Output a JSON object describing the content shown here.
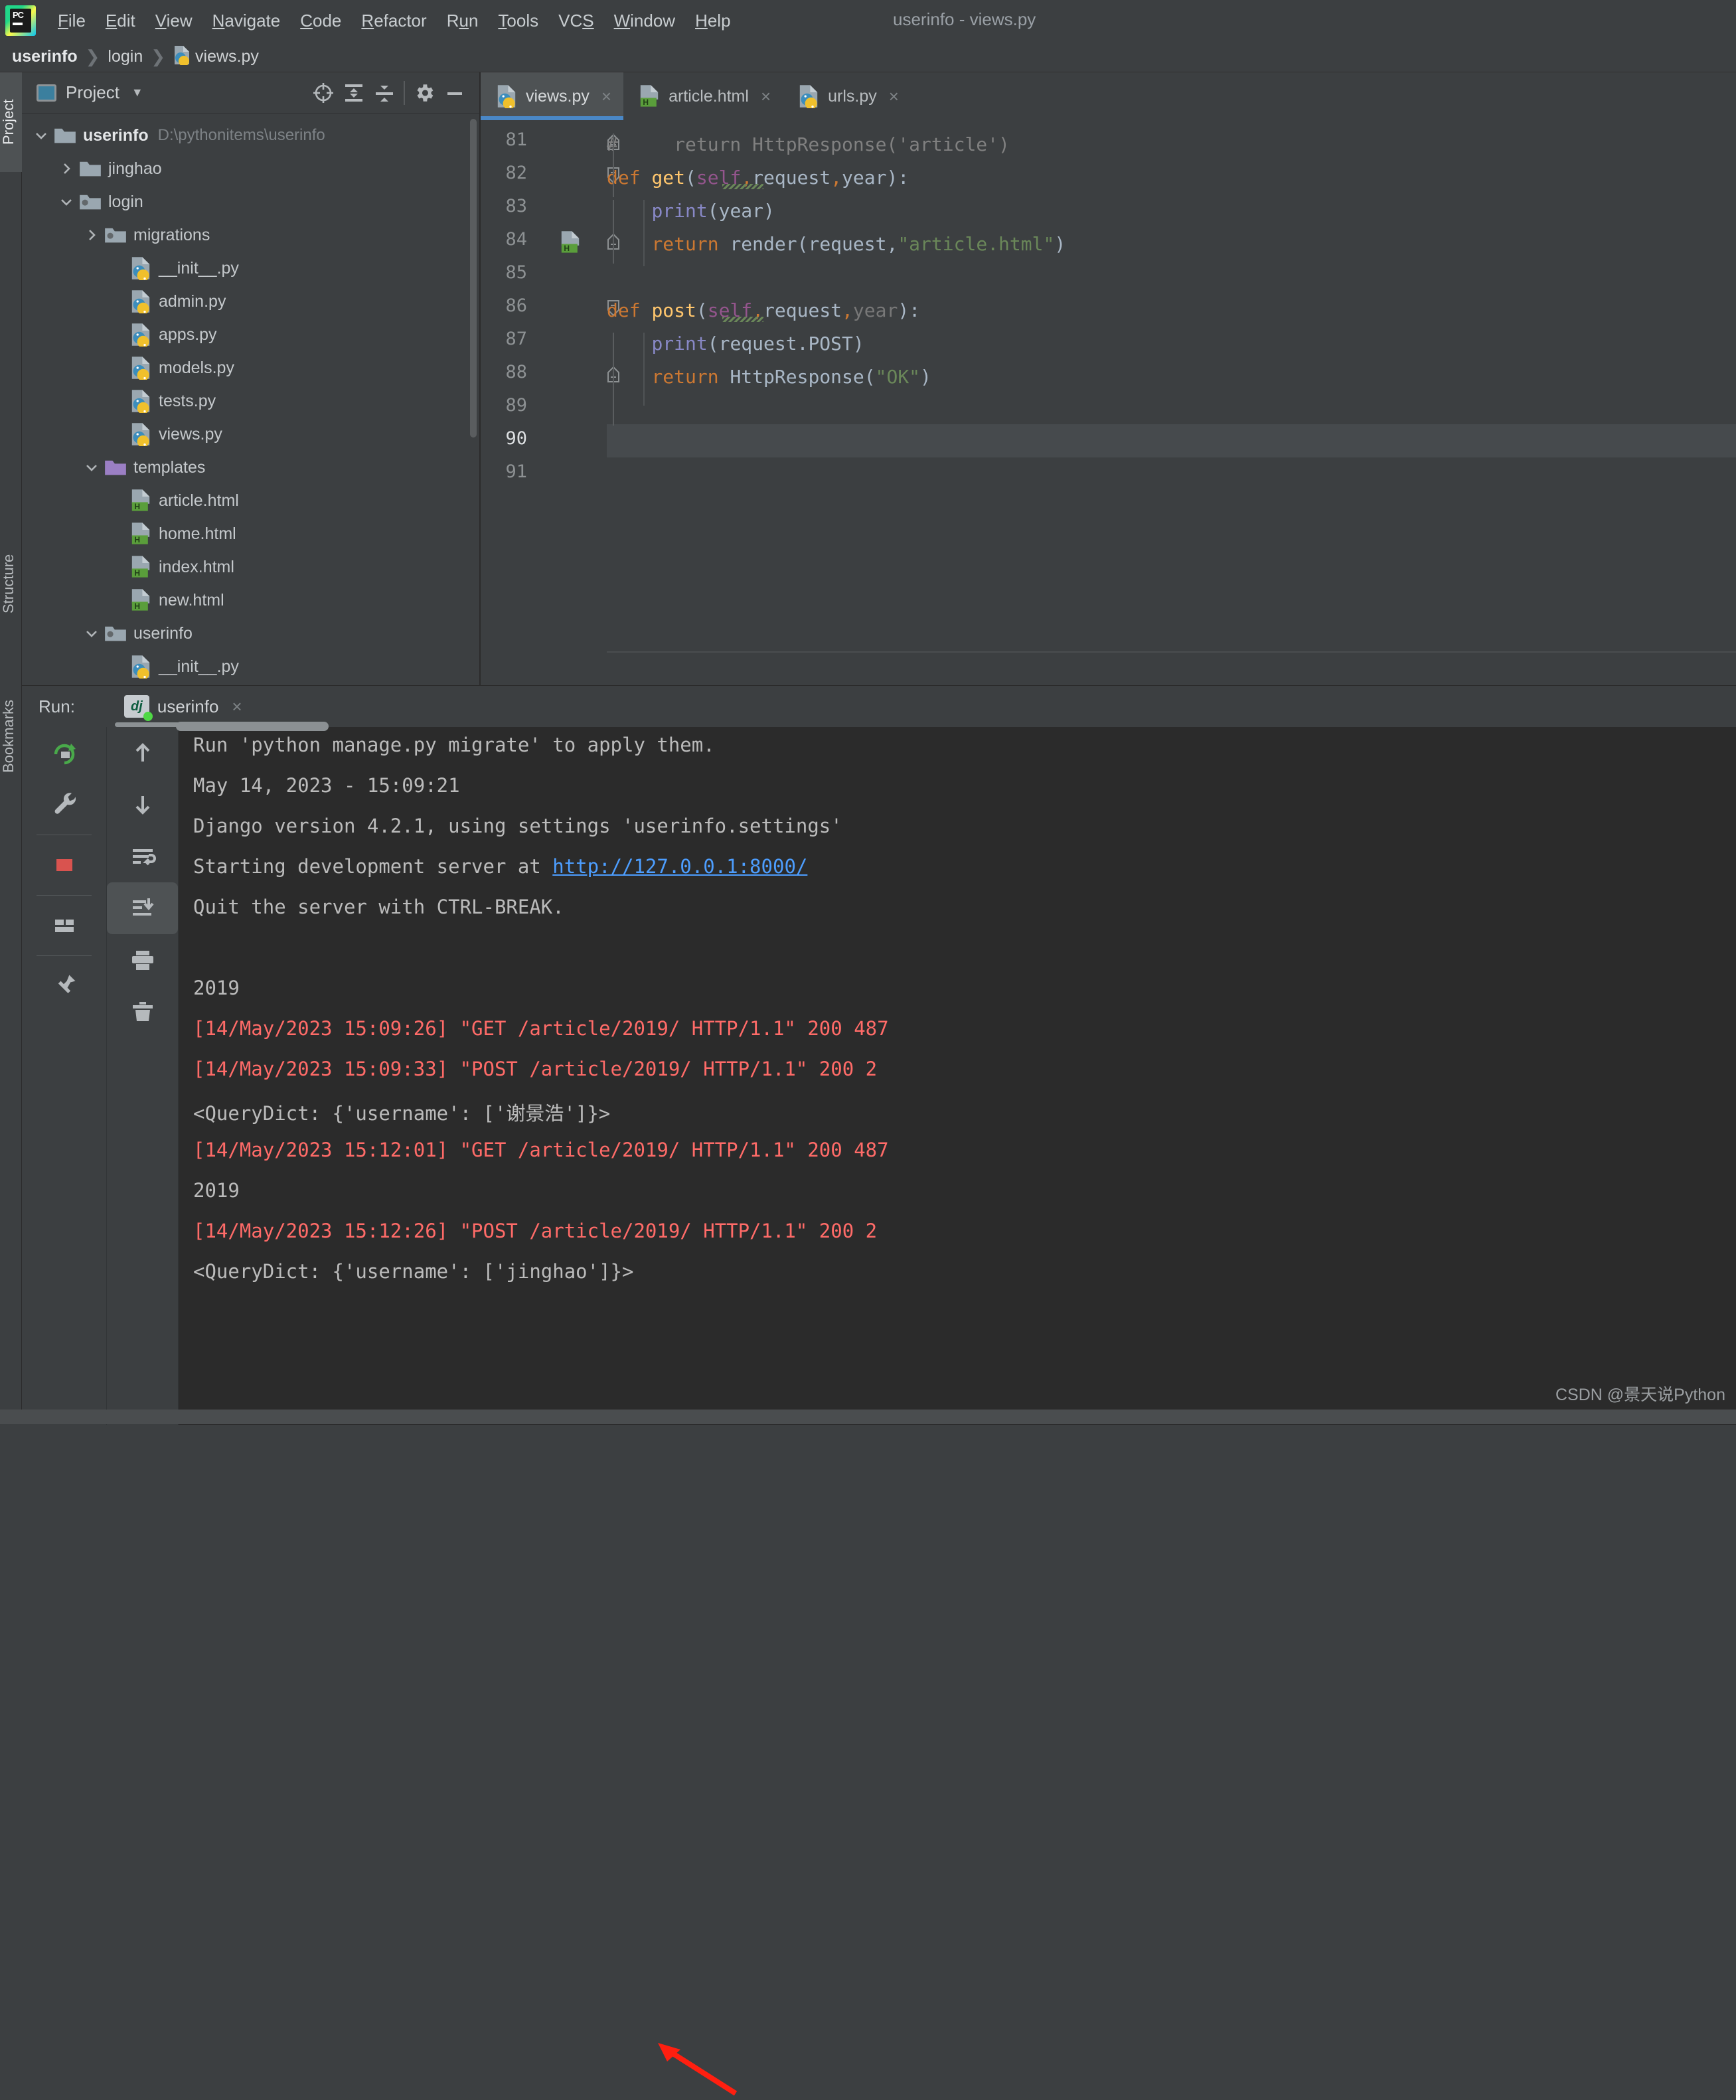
{
  "window": {
    "title": "userinfo - views.py"
  },
  "menubar": {
    "logo": "pycharm-logo",
    "items": [
      {
        "label": "File",
        "mnemonic": "F"
      },
      {
        "label": "Edit",
        "mnemonic": "E"
      },
      {
        "label": "View",
        "mnemonic": "V"
      },
      {
        "label": "Navigate",
        "mnemonic": "N"
      },
      {
        "label": "Code",
        "mnemonic": "C"
      },
      {
        "label": "Refactor",
        "mnemonic": "R"
      },
      {
        "label": "Run",
        "mnemonic": "u"
      },
      {
        "label": "Tools",
        "mnemonic": "T"
      },
      {
        "label": "VCS",
        "mnemonic": "S"
      },
      {
        "label": "Window",
        "mnemonic": "W"
      },
      {
        "label": "Help",
        "mnemonic": "H"
      }
    ]
  },
  "breadcrumb": {
    "items": [
      "userinfo",
      "login",
      "views.py"
    ]
  },
  "left_rail": {
    "tabs": [
      "Project",
      "Structure",
      "Bookmarks"
    ],
    "selected": "Project"
  },
  "project_panel": {
    "title": "Project",
    "toolbar_icons": [
      "locate-target-icon",
      "expand-all-icon",
      "collapse-all-icon",
      "settings-gear-icon",
      "hide-panel-icon"
    ],
    "tree": [
      {
        "label": "userinfo",
        "path": "D:\\pythonitems\\userinfo",
        "icon": "folder-icon",
        "arrow": "expanded",
        "indent": 0,
        "bold": true
      },
      {
        "label": "jinghao",
        "path": "",
        "icon": "folder-icon",
        "arrow": "collapsed",
        "indent": 1,
        "bold": false
      },
      {
        "label": "login",
        "path": "",
        "icon": "folder-module-icon",
        "arrow": "expanded",
        "indent": 1,
        "bold": false
      },
      {
        "label": "migrations",
        "path": "",
        "icon": "folder-module-icon",
        "arrow": "collapsed",
        "indent": 2,
        "bold": false
      },
      {
        "label": "__init__.py",
        "path": "",
        "icon": "python-file-icon",
        "arrow": "none",
        "indent": 3,
        "bold": false
      },
      {
        "label": "admin.py",
        "path": "",
        "icon": "python-file-icon",
        "arrow": "none",
        "indent": 3,
        "bold": false
      },
      {
        "label": "apps.py",
        "path": "",
        "icon": "python-file-icon",
        "arrow": "none",
        "indent": 3,
        "bold": false
      },
      {
        "label": "models.py",
        "path": "",
        "icon": "python-file-icon",
        "arrow": "none",
        "indent": 3,
        "bold": false
      },
      {
        "label": "tests.py",
        "path": "",
        "icon": "python-file-icon",
        "arrow": "none",
        "indent": 3,
        "bold": false
      },
      {
        "label": "views.py",
        "path": "",
        "icon": "python-file-icon",
        "arrow": "none",
        "indent": 3,
        "bold": false
      },
      {
        "label": "templates",
        "path": "",
        "icon": "folder-templates-icon",
        "arrow": "expanded",
        "indent": 2,
        "bold": false
      },
      {
        "label": "article.html",
        "path": "",
        "icon": "html-file-icon",
        "arrow": "none",
        "indent": 3,
        "bold": false
      },
      {
        "label": "home.html",
        "path": "",
        "icon": "html-file-icon",
        "arrow": "none",
        "indent": 3,
        "bold": false
      },
      {
        "label": "index.html",
        "path": "",
        "icon": "html-file-icon",
        "arrow": "none",
        "indent": 3,
        "bold": false
      },
      {
        "label": "new.html",
        "path": "",
        "icon": "html-file-icon",
        "arrow": "none",
        "indent": 3,
        "bold": false
      },
      {
        "label": "userinfo",
        "path": "",
        "icon": "folder-module-icon",
        "arrow": "expanded",
        "indent": 2,
        "bold": false
      },
      {
        "label": "__init__.py",
        "path": "",
        "icon": "python-file-icon",
        "arrow": "none",
        "indent": 3,
        "bold": false
      }
    ]
  },
  "editor": {
    "tabs": [
      {
        "label": "views.py",
        "icon": "python-file-icon",
        "active": true,
        "close": "×"
      },
      {
        "label": "article.html",
        "icon": "html-file-icon",
        "active": false,
        "close": "×"
      },
      {
        "label": "urls.py",
        "icon": "python-file-icon",
        "active": false,
        "close": "×"
      }
    ],
    "current_line": 90,
    "lines": [
      {
        "num": "81",
        "fold": "end",
        "gutter": "",
        "tokens": [
          {
            "t": "#     return HttpResponse('article')",
            "c": "k-cmt"
          }
        ]
      },
      {
        "num": "82",
        "fold": "start",
        "gutter": "",
        "tokens": [
          {
            "t": "def ",
            "c": "k-key"
          },
          {
            "t": "get",
            "c": "k-fn"
          },
          {
            "t": "(",
            "c": "k-def"
          },
          {
            "t": "self",
            "c": "k-self"
          },
          {
            "t": ",",
            "c": "k-comma"
          },
          {
            "t": "request",
            "c": "k-param"
          },
          {
            "t": ",",
            "c": "k-comma"
          },
          {
            "t": "year",
            "c": "k-param"
          },
          {
            "t": "):",
            "c": "k-def"
          }
        ]
      },
      {
        "num": "83",
        "fold": "",
        "gutter": "",
        "tokens": [
          {
            "t": "    ",
            "c": "k-def"
          },
          {
            "t": "print",
            "c": "k-builtin"
          },
          {
            "t": "(year)",
            "c": "k-def"
          }
        ]
      },
      {
        "num": "84",
        "fold": "end",
        "gutter": "html-file-icon",
        "tokens": [
          {
            "t": "    ",
            "c": "k-def"
          },
          {
            "t": "return ",
            "c": "k-key"
          },
          {
            "t": "render(request,",
            "c": "k-def"
          },
          {
            "t": "\"article.html\"",
            "c": "k-str"
          },
          {
            "t": ")",
            "c": "k-def"
          }
        ]
      },
      {
        "num": "85",
        "fold": "",
        "gutter": "",
        "tokens": []
      },
      {
        "num": "86",
        "fold": "start",
        "gutter": "",
        "tokens": [
          {
            "t": "def ",
            "c": "k-key"
          },
          {
            "t": "post",
            "c": "k-fn"
          },
          {
            "t": "(",
            "c": "k-def"
          },
          {
            "t": "self",
            "c": "k-self"
          },
          {
            "t": ",",
            "c": "k-comma"
          },
          {
            "t": "request",
            "c": "k-param"
          },
          {
            "t": ",",
            "c": "k-comma"
          },
          {
            "t": "year",
            "c": "k-dim"
          },
          {
            "t": "):",
            "c": "k-def"
          }
        ]
      },
      {
        "num": "87",
        "fold": "",
        "gutter": "",
        "tokens": [
          {
            "t": "    ",
            "c": "k-def"
          },
          {
            "t": "print",
            "c": "k-builtin"
          },
          {
            "t": "(request.POST)",
            "c": "k-def"
          }
        ]
      },
      {
        "num": "88",
        "fold": "end",
        "gutter": "",
        "tokens": [
          {
            "t": "    ",
            "c": "k-def"
          },
          {
            "t": "return ",
            "c": "k-key"
          },
          {
            "t": "HttpResponse(",
            "c": "k-def"
          },
          {
            "t": "\"OK\"",
            "c": "k-str"
          },
          {
            "t": ")",
            "c": "k-def"
          }
        ]
      },
      {
        "num": "89",
        "fold": "",
        "gutter": "",
        "tokens": []
      },
      {
        "num": "90",
        "fold": "",
        "gutter": "",
        "tokens": []
      },
      {
        "num": "91",
        "fold": "",
        "gutter": "",
        "tokens": []
      }
    ]
  },
  "run_panel": {
    "label": "Run:",
    "tab_name": "userinfo",
    "tab_icon": "django-icon",
    "tab_close": "×",
    "tools_left": [
      "rerun-icon",
      "settings-wrench-icon",
      "stop-icon",
      "layout-icon",
      "pin-icon"
    ],
    "tools_right": [
      "scroll-up-icon",
      "scroll-down-icon",
      "soft-wrap-icon",
      "scroll-to-end-icon",
      "print-icon",
      "trash-icon"
    ],
    "console": [
      {
        "text": "Run 'python manage.py migrate' to apply them.",
        "color": "c-white"
      },
      {
        "text": "May 14, 2023 - 15:09:21",
        "color": "c-white"
      },
      {
        "text": "Django version 4.2.1, using settings 'userinfo.settings'",
        "color": "c-white"
      },
      {
        "text": "Starting development server at ",
        "color": "c-white",
        "link": "http://127.0.0.1:8000/"
      },
      {
        "text": "Quit the server with CTRL-BREAK.",
        "color": "c-white"
      },
      {
        "text": "",
        "color": "c-white"
      },
      {
        "text": "2019",
        "color": "c-white"
      },
      {
        "text": "[14/May/2023 15:09:26] \"GET /article/2019/ HTTP/1.1\" 200 487",
        "color": "c-red"
      },
      {
        "text": "[14/May/2023 15:09:33] \"POST /article/2019/ HTTP/1.1\" 200 2",
        "color": "c-red"
      },
      {
        "text": "<QueryDict: {'username': ['谢景浩']}>",
        "color": "c-white"
      },
      {
        "text": "[14/May/2023 15:12:01] \"GET /article/2019/ HTTP/1.1\" 200 487",
        "color": "c-red"
      },
      {
        "text": "2019",
        "color": "c-white"
      },
      {
        "text": "[14/May/2023 15:12:26] \"POST /article/2019/ HTTP/1.1\" 200 2",
        "color": "c-red"
      },
      {
        "text": "<QueryDict: {'username': ['jinghao']}>",
        "color": "c-white"
      }
    ]
  },
  "watermark": {
    "text": "CSDN @景天说Python"
  },
  "colors": {
    "panel_bg": "#3c3f41",
    "console_bg": "#2b2b2b",
    "accent_tab": "#4a88c7",
    "error_red": "#ff6b68",
    "link_blue": "#4d9eff",
    "annotation_red": "#ff1f10",
    "string_green": "#6a8759",
    "keyword_orange": "#cc7832",
    "function_yellow": "#ffc66d"
  }
}
